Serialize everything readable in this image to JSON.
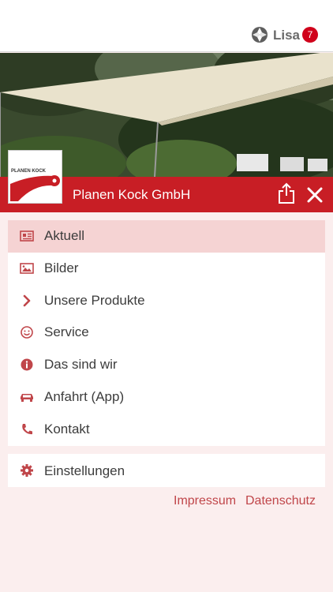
{
  "topbar": {
    "hub_icon": "community-hub-icon",
    "user_name": "Lisa",
    "badge_count": "7"
  },
  "hero": {
    "image": "garden-sun-sail-photo"
  },
  "logo": {
    "text": "PLANEN KOCK"
  },
  "titlebar": {
    "company_name": "Planen Kock GmbH",
    "share_icon": "share-icon",
    "close_icon": "close-icon"
  },
  "menu": {
    "items": [
      {
        "label": "Aktuell",
        "icon": "newspaper-icon",
        "active": true
      },
      {
        "label": "Bilder",
        "icon": "image-icon",
        "active": false
      },
      {
        "label": "Unsere Produkte",
        "icon": "chevron-right-icon",
        "active": false
      },
      {
        "label": "Service",
        "icon": "smiley-icon",
        "active": false
      },
      {
        "label": "Das sind wir",
        "icon": "info-icon",
        "active": false
      },
      {
        "label": "Anfahrt (App)",
        "icon": "car-icon",
        "active": false
      },
      {
        "label": "Kontakt",
        "icon": "phone-icon",
        "active": false
      }
    ]
  },
  "settings": {
    "label": "Einstellungen",
    "icon": "gear-icon"
  },
  "footer": {
    "impressum": "Impressum",
    "datenschutz": "Datenschutz"
  },
  "colors": {
    "brand_red": "#c81e25",
    "icon_red": "#c0464a",
    "active_bg": "#f5d3d3",
    "page_bg": "#fbeeee"
  }
}
